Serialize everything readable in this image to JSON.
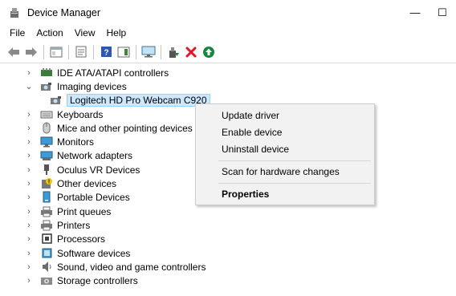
{
  "window": {
    "title": "Device Manager",
    "minimize": "—",
    "maximize": "☐"
  },
  "menu": [
    "File",
    "Action",
    "View",
    "Help"
  ],
  "tree": {
    "items": [
      {
        "label": "IDE ATA/ATAPI controllers",
        "icon": "ide-controller-icon",
        "expanded": false
      },
      {
        "label": "Imaging devices",
        "icon": "camera-icon",
        "expanded": true
      },
      {
        "label": "Logitech HD Pro Webcam C920",
        "icon": "webcam-icon",
        "child": true,
        "selected": true
      },
      {
        "label": "Keyboards",
        "icon": "keyboard-icon",
        "expanded": false
      },
      {
        "label": "Mice and other pointing devices",
        "icon": "mouse-icon",
        "expanded": false
      },
      {
        "label": "Monitors",
        "icon": "monitor-icon",
        "expanded": false
      },
      {
        "label": "Network adapters",
        "icon": "network-adapter-icon",
        "expanded": false
      },
      {
        "label": "Oculus VR Devices",
        "icon": "usb-icon",
        "expanded": false
      },
      {
        "label": "Other devices",
        "icon": "unknown-device-icon",
        "expanded": false
      },
      {
        "label": "Portable Devices",
        "icon": "portable-device-icon",
        "expanded": false
      },
      {
        "label": "Print queues",
        "icon": "printer-icon",
        "expanded": false
      },
      {
        "label": "Printers",
        "icon": "printer-icon",
        "expanded": false
      },
      {
        "label": "Processors",
        "icon": "processor-icon",
        "expanded": false
      },
      {
        "label": "Software devices",
        "icon": "software-device-icon",
        "expanded": false
      },
      {
        "label": "Sound, video and game controllers",
        "icon": "speaker-icon",
        "expanded": false
      },
      {
        "label": "Storage controllers",
        "icon": "storage-controller-icon",
        "expanded": false
      }
    ]
  },
  "context_menu": {
    "update_driver": "Update driver",
    "enable_device": "Enable device",
    "uninstall_device": "Uninstall device",
    "scan": "Scan for hardware changes",
    "properties": "Properties"
  },
  "colors": {
    "selection_bg": "#cce8ff",
    "selection_border": "#99d1ff",
    "menu_bg": "#f2f2f2",
    "delete_red": "#e81123",
    "enable_green": "#10893e"
  }
}
